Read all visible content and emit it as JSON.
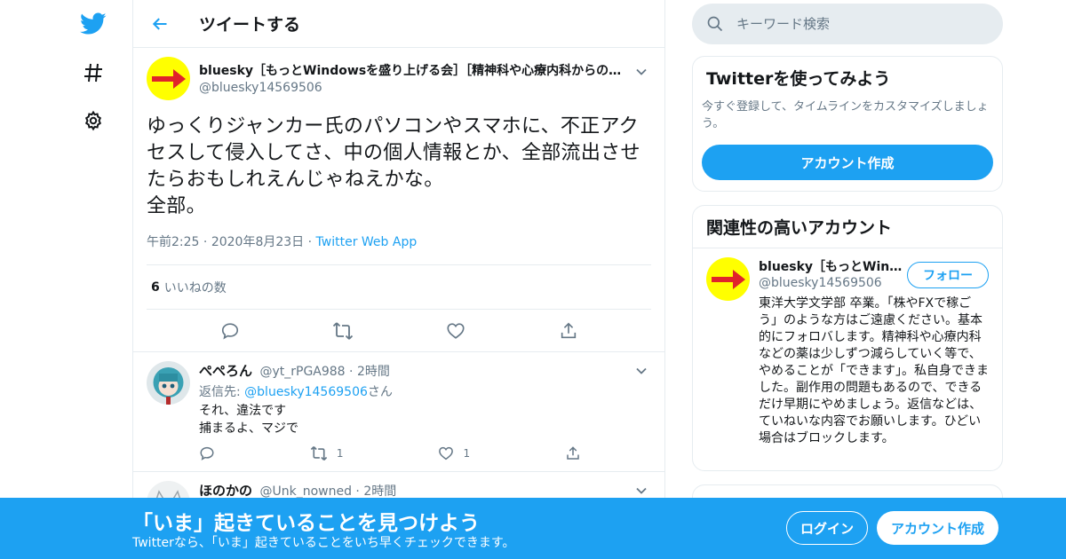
{
  "colors": {
    "accent": "#1da1f2",
    "muted": "#657786",
    "avatar_bg": "#ffff00",
    "arrow": "#e0242b"
  },
  "nav": {
    "items": [
      "twitter-logo-icon",
      "hashtag-icon",
      "gear-icon"
    ]
  },
  "header": {
    "title": "ツイートする"
  },
  "tweet": {
    "author_name": "bluesky［もっとWindowsを盛り上げる会］［精神科や心療内科からの薬を減らす会］",
    "author_handle": "@bluesky14569506",
    "text": "ゆっくりジャンカー氏のパソコンやスマホに、不正アクセスして侵入してさ、中の個人情報とか、全部流出させたらおもしれえんじゃねえかな。\n全部。",
    "time": "午前2:25",
    "date": "2020年8月23日",
    "source": "Twitter Web App",
    "sep": "·",
    "likes_count": "6",
    "likes_label": "いいねの数"
  },
  "replies": [
    {
      "name": "ぺぺろん",
      "handle": "@yt_rPGA988",
      "time": "2時間",
      "reply_to_prefix": "返信先:",
      "reply_to": "@bluesky14569506",
      "reply_to_suffix": "さん",
      "text": "それ、違法です\n捕まるよ、マジで",
      "retweets": "1",
      "likes": "1"
    },
    {
      "name": "ほのかの",
      "handle": "@Unk_nowned",
      "time": "2時間"
    }
  ],
  "search": {
    "placeholder": "キーワード検索"
  },
  "signup_card": {
    "title": "Twitterを使ってみよう",
    "subtitle": "今すぐ登録して、タイムラインをカスタマイズしましょう。",
    "button": "アカウント作成"
  },
  "related_card": {
    "title": "関連性の高いアカウント",
    "name": "bluesky［もっとWindowsを盛り上げる会］",
    "handle": "@bluesky14569506",
    "follow": "フォロー",
    "bio": "東洋大学文学部 卒業。「株やFXで稼ごう」のような方はご遠慮ください。基本的にフォロバします。精神科や心療内科などの薬は少しずつ減らしていく等で、やめることが「できます」。私自身できました。副作用の問題もあるので、できるだけ早期にやめましょう。返信などは、ていねいな内容でお願いします。ひどい場合はブロックします。"
  },
  "banner": {
    "title": "「いま」起きていることを見つけよう",
    "subtitle": "Twitterなら、「いま」起きていることをいち早くチェックできます。",
    "login": "ログイン",
    "signup": "アカウント作成"
  }
}
